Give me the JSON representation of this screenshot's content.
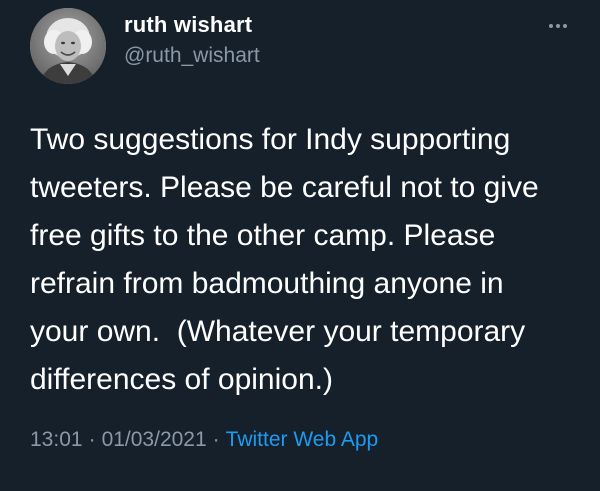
{
  "colors": {
    "background": "#15202b",
    "text": "#ffffff",
    "muted": "#8b98a5",
    "accent": "#1d9bf0"
  },
  "author": {
    "display_name": "ruth wishart",
    "handle": "@ruth_wishart",
    "avatar_icon": "profile-photo"
  },
  "menu": {
    "icon": "more-horizontal-icon"
  },
  "tweet": {
    "text": "Two suggestions for Indy supporting\ntweeters. Please be careful not to give\nfree gifts to the other camp. Please\nrefrain from badmouthing anyone in\nyour own.  (Whatever your temporary\ndifferences of opinion.)",
    "time": "13:01",
    "date": "01/03/2021",
    "separator": "·",
    "source": "Twitter Web App"
  }
}
